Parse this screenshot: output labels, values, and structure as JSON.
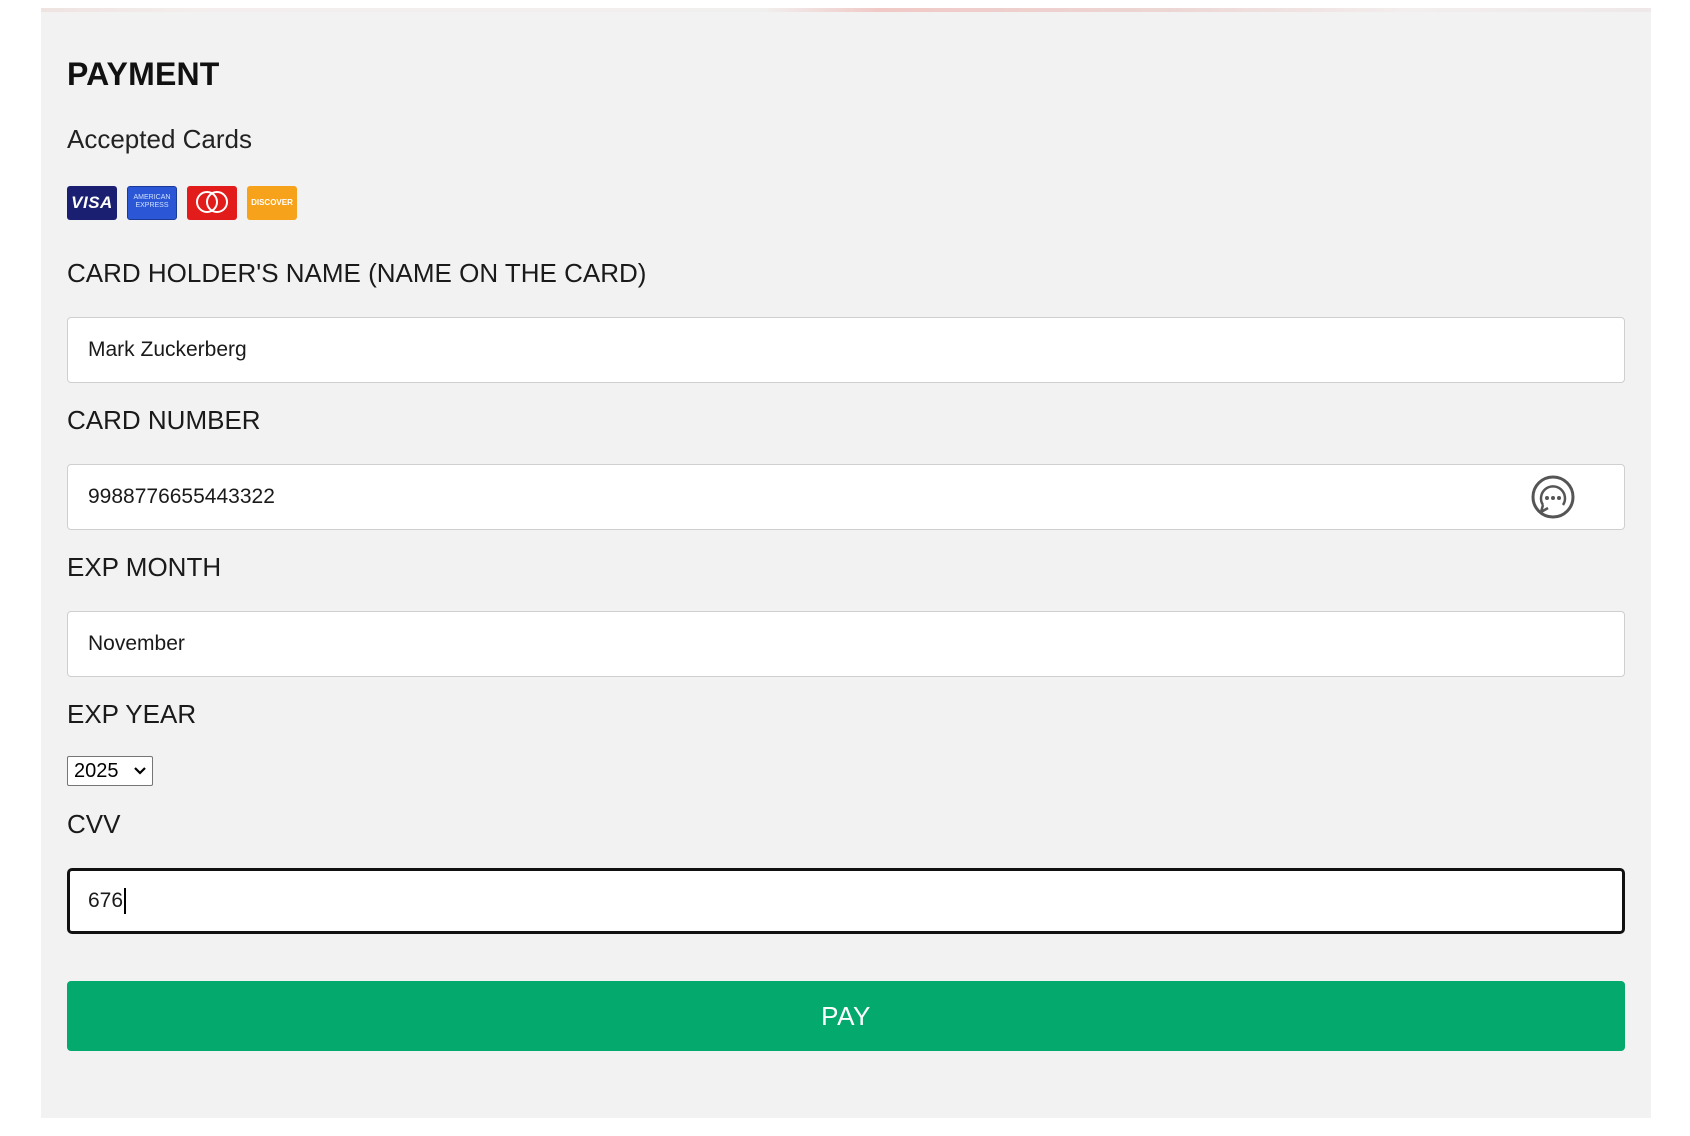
{
  "page": {
    "clipped_heading": "payment"
  },
  "payment": {
    "title": "PAYMENT",
    "accepted_cards_label": "Accepted Cards",
    "cards": [
      {
        "name": "visa",
        "text": "VISA"
      },
      {
        "name": "amex",
        "text": "AMERICAN EXPRESS"
      },
      {
        "name": "mastercard",
        "text": "mastercard"
      },
      {
        "name": "discover",
        "text": "DISCOVER"
      }
    ]
  },
  "fields": {
    "card_holder": {
      "label": "CARD HOLDER'S NAME (NAME ON THE CARD)",
      "value": "Mark Zuckerberg"
    },
    "card_number": {
      "label": "CARD NUMBER",
      "value": "9988776655443322"
    },
    "exp_month": {
      "label": "EXP MONTH",
      "value": "November"
    },
    "exp_year": {
      "label": "EXP YEAR",
      "selected": "2025"
    },
    "cvv": {
      "label": "CVV",
      "value": "676"
    }
  },
  "actions": {
    "pay_label": "PAY"
  },
  "colors": {
    "panel_bg": "#f2f2f2",
    "pay_button": "#04aa6d",
    "focus_border": "#111111"
  },
  "icons": {
    "autofill": "chat-bubble-icon",
    "dropdown": "chevron-down-icon"
  }
}
